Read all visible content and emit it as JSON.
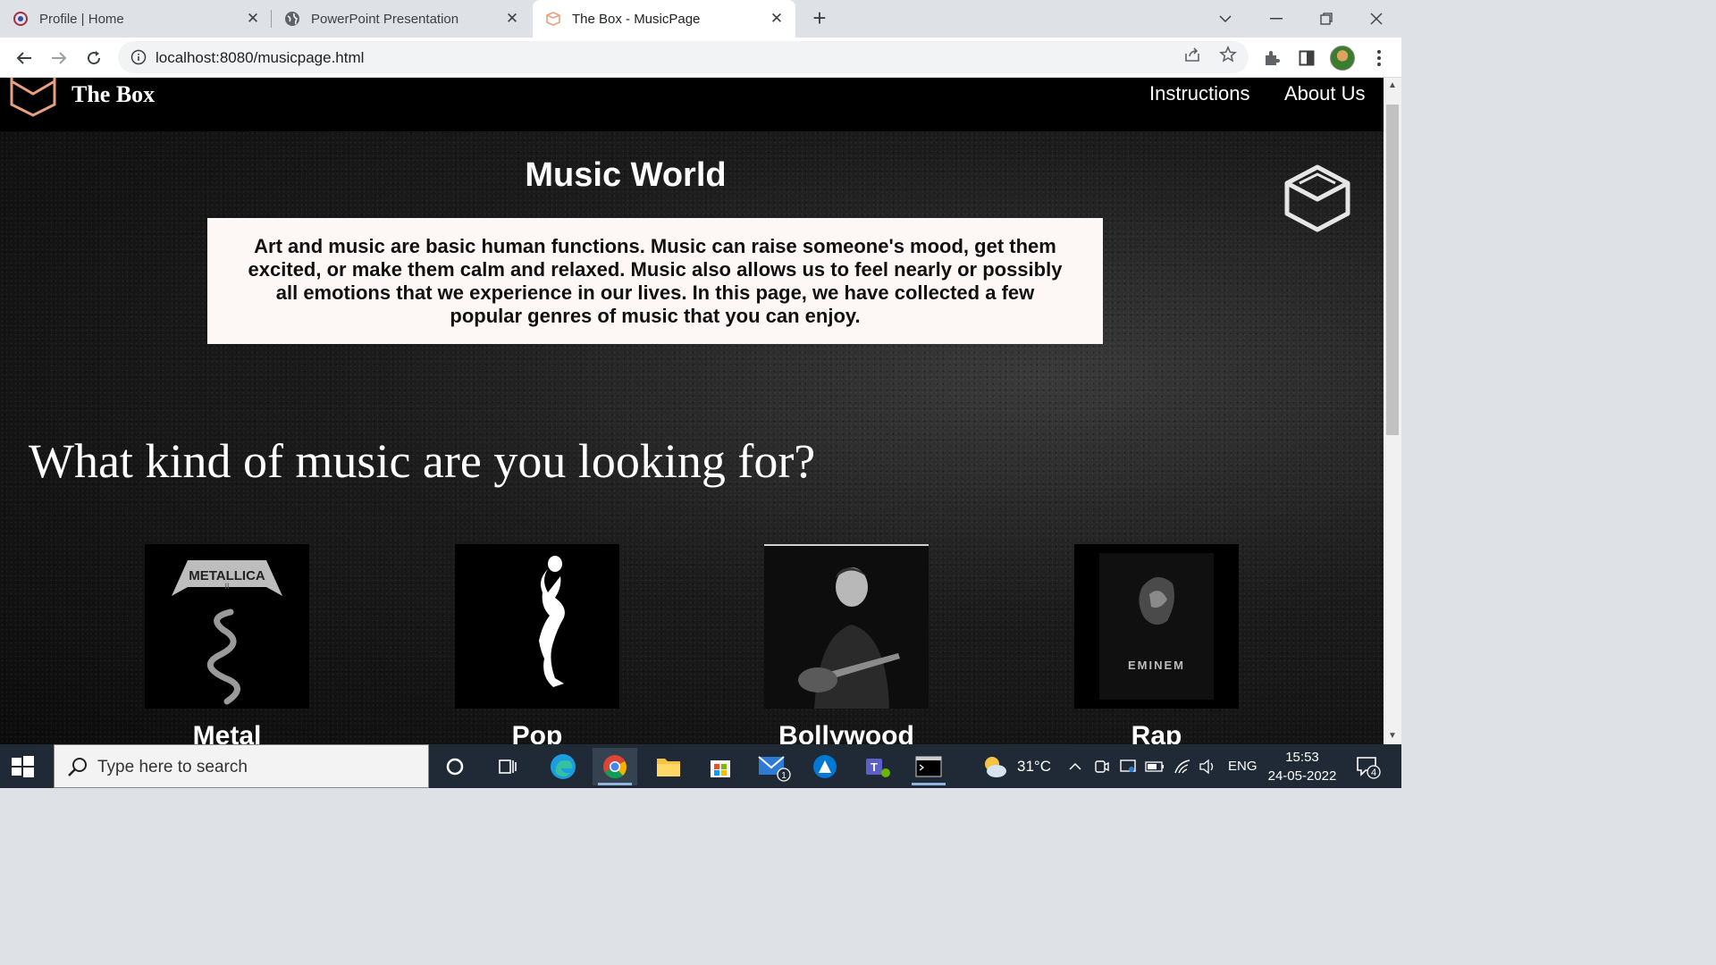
{
  "browser": {
    "tabs": [
      {
        "title": "Profile | Home",
        "icon": "profile-favicon",
        "active": false
      },
      {
        "title": "PowerPoint Presentation",
        "icon": "globe-icon",
        "active": false
      },
      {
        "title": "The Box - MusicPage",
        "icon": "box-favicon",
        "active": true
      }
    ],
    "url": "localhost:8080/musicpage.html"
  },
  "site": {
    "brand": "The Box",
    "nav": [
      {
        "label": "Instructions"
      },
      {
        "label": "About Us"
      }
    ]
  },
  "main": {
    "title": "Music World",
    "intro": "Art and music are basic human functions. Music can raise someone's mood, get them excited, or make them calm and relaxed. Music also allows us to feel nearly or possibly all emotions that we experience in our lives. In this page, we have collected a few popular genres of music that you can enjoy.",
    "question": "What kind of music are you looking for?",
    "genres": [
      {
        "label": "Metal",
        "art_text": "METALLICA",
        "art_sub": "II"
      },
      {
        "label": "Pop",
        "art_text": ""
      },
      {
        "label": "Bollywood",
        "art_text": ""
      },
      {
        "label": "Rap",
        "art_text": "EMINEM"
      }
    ]
  },
  "taskbar": {
    "search_placeholder": "Type here to search",
    "weather": "31°C",
    "language": "ENG",
    "time": "15:53",
    "date": "24-05-2022",
    "mail_badge": "1",
    "notification_badge": "4"
  },
  "colors": {
    "accent_logo": "#e8a080",
    "header_bg": "#000000",
    "intro_bg": "#fdf7f6",
    "taskbar_bg": "#1f2a36"
  }
}
